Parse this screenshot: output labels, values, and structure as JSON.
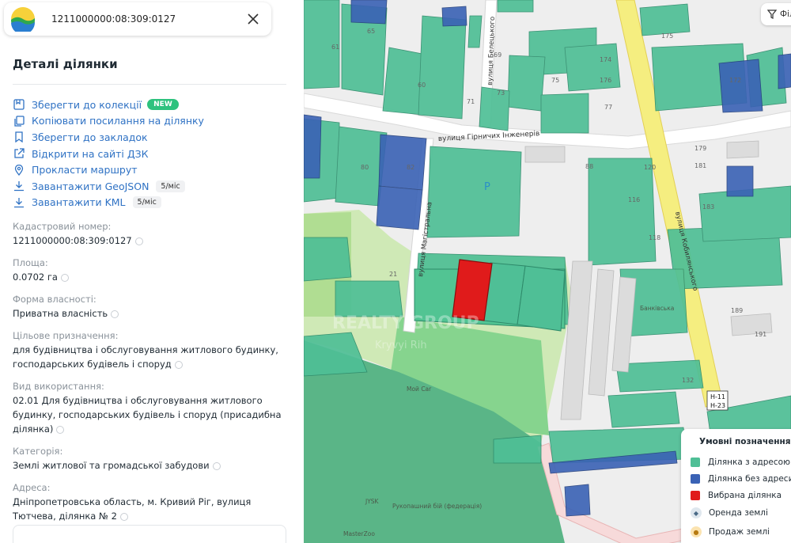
{
  "search": {
    "value": "1211000000:08:309:0127"
  },
  "panel": {
    "title": "Деталі ділянки",
    "actions": [
      {
        "label": "Зберегти до колекції",
        "icon": "collection-icon",
        "badge": "NEW"
      },
      {
        "label": "Копіювати посилання на ділянку",
        "icon": "copy-link-icon"
      },
      {
        "label": "Зберегти до закладок",
        "icon": "bookmark-icon"
      },
      {
        "label": "Відкрити на сайті ДЗК",
        "icon": "external-link-icon"
      },
      {
        "label": "Прокласти маршрут",
        "icon": "location-pin-icon"
      },
      {
        "label": "Завантажити GeoJSON",
        "icon": "download-icon",
        "rate": "5/міс"
      },
      {
        "label": "Завантажити KML",
        "icon": "download-icon",
        "rate": "5/міс"
      }
    ],
    "fields": [
      {
        "label": "Кадастровий номер:",
        "value": "1211000000:08:309:0127"
      },
      {
        "label": "Площа:",
        "value": "0.0702 га"
      },
      {
        "label": "Форма власності:",
        "value": "Приватна власність"
      },
      {
        "label": "Цільове призначення:",
        "value": "для будівництва і обслуговування житлового будинку, господарських будівель і споруд"
      },
      {
        "label": "Вид використання:",
        "value": "02.01 Для будівництва і обслуговування житлового будинку, господарських будівель і споруд (присадибна ділянка)"
      },
      {
        "label": "Категорія:",
        "value": "Землі житлової та громадської забудови"
      },
      {
        "label": "Адреса:",
        "value": "Дніпропетровська область, м. Кривий Ріг, вулиця Тютчева, ділянка № 2"
      }
    ]
  },
  "map": {
    "filter_label": "Філ",
    "streets": {
      "beletskoho": "вулиця Белецького",
      "hirnychykh": "вулиця Гірничих Інженерів",
      "mahistralna": "вулиця Магістральна",
      "kobylianskoho": "вулиця Кобилянського"
    },
    "numbers": [
      "65",
      "61",
      "60",
      "71",
      "75",
      "69",
      "73",
      "77",
      "174",
      "176",
      "175",
      "172",
      "80",
      "82",
      "88",
      "120",
      "179",
      "181",
      "183",
      "118",
      "116",
      "21",
      "189",
      "191",
      "132"
    ],
    "poi": {
      "parking": "P",
      "carwash": "Мой Car",
      "bank": "Банківська",
      "sport": "Рукопашний бій (федерація)",
      "vet": "MasterZoo",
      "jysk": "JYSK"
    },
    "road_signs": [
      "H-11",
      "H-23"
    ],
    "watermark": {
      "title": "REALTY GROUP",
      "subtitle": "Kryvyi Rih"
    },
    "colors": {
      "with_address": "#4fbf96",
      "without_address": "#3a62b5",
      "selected": "#e01b1b",
      "road_main": "#f7f28a"
    }
  },
  "legend": {
    "title": "Умовні позначення",
    "items": [
      {
        "label": "Ділянка з адресою",
        "color": "#4fbf96"
      },
      {
        "label": "Ділянка без адреси",
        "color": "#3a62b5"
      },
      {
        "label": "Вибрана ділянка",
        "color": "#e01b1b"
      },
      {
        "label": "Оренда землі",
        "icon": "rent-icon"
      },
      {
        "label": "Продаж землі",
        "icon": "sale-icon"
      }
    ]
  }
}
